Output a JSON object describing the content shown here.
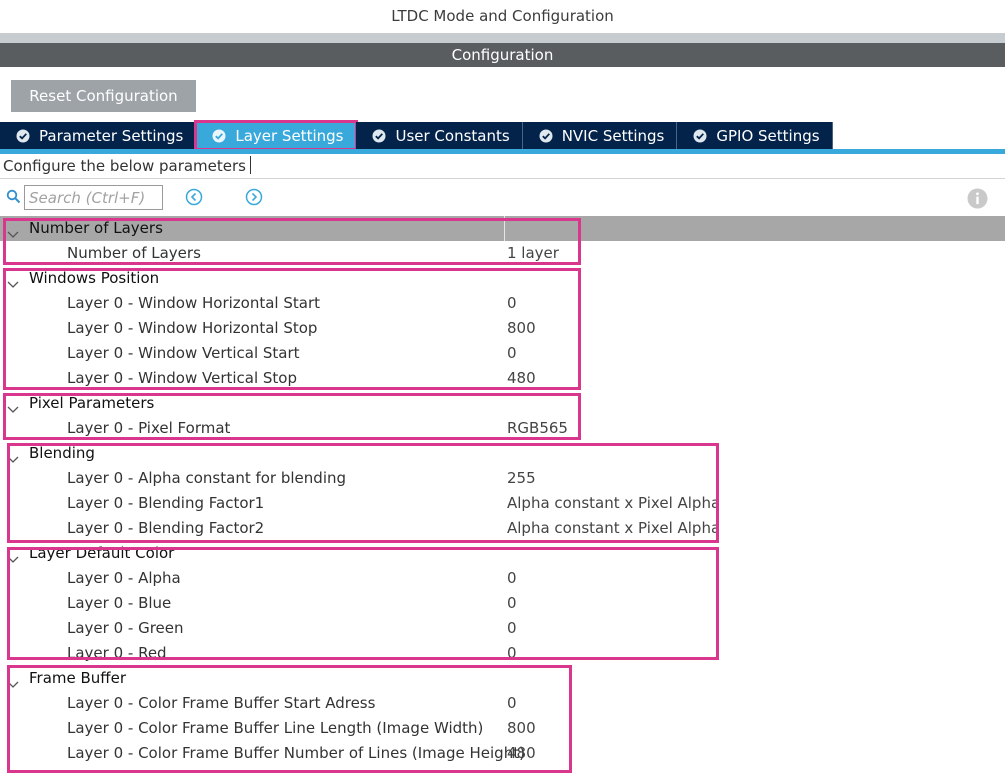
{
  "window": {
    "title": "LTDC Mode and Configuration"
  },
  "config_header": "Configuration",
  "reset_button": "Reset Configuration",
  "tabs": [
    {
      "label": "Parameter Settings",
      "icon": "check-circle-icon",
      "active": false
    },
    {
      "label": "Layer Settings",
      "icon": "check-circle-icon",
      "active": true
    },
    {
      "label": "User Constants",
      "icon": "check-circle-icon",
      "active": false
    },
    {
      "label": "NVIC Settings",
      "icon": "check-circle-icon",
      "active": false
    },
    {
      "label": "GPIO Settings",
      "icon": "check-circle-icon",
      "active": false
    }
  ],
  "hint": "Configure the below parameters",
  "search": {
    "placeholder": "Search (Ctrl+F)"
  },
  "colors": {
    "tab_bg": "#03234b",
    "tab_active_bg": "#39a9dc",
    "highlight": "#d9378d",
    "header_bg": "#5a5d60"
  },
  "groups": [
    {
      "name": "Number of Layers",
      "params": [
        {
          "name": "Number of Layers",
          "value": "1 layer"
        }
      ]
    },
    {
      "name": "Windows Position",
      "params": [
        {
          "name": "Layer 0 - Window Horizontal Start",
          "value": "0"
        },
        {
          "name": "Layer 0 - Window Horizontal Stop",
          "value": "800"
        },
        {
          "name": "Layer 0 - Window Vertical Start",
          "value": "0"
        },
        {
          "name": "Layer 0 - Window Vertical Stop",
          "value": "480"
        }
      ]
    },
    {
      "name": "Pixel Parameters",
      "params": [
        {
          "name": "Layer 0 - Pixel Format",
          "value": "RGB565"
        }
      ]
    },
    {
      "name": "Blending",
      "params": [
        {
          "name": "Layer 0 - Alpha constant for blending",
          "value": "255"
        },
        {
          "name": "Layer 0 - Blending Factor1",
          "value": "Alpha constant x Pixel Alpha"
        },
        {
          "name": "Layer 0 - Blending Factor2",
          "value": "Alpha constant x Pixel Alpha"
        }
      ]
    },
    {
      "name": "Layer Default Color",
      "params": [
        {
          "name": "Layer 0 - Alpha",
          "value": "0"
        },
        {
          "name": "Layer 0 - Blue",
          "value": "0"
        },
        {
          "name": "Layer 0 - Green",
          "value": "0"
        },
        {
          "name": "Layer 0 - Red",
          "value": "0"
        }
      ]
    },
    {
      "name": "Frame Buffer",
      "params": [
        {
          "name": "Layer 0 - Color Frame Buffer Start Adress",
          "value": "0"
        },
        {
          "name": "Layer 0 - Color Frame Buffer Line Length (Image Width)",
          "value": "800"
        },
        {
          "name": "Layer 0 - Color Frame Buffer Number of Lines (Image Height)",
          "value": "480"
        }
      ]
    }
  ]
}
